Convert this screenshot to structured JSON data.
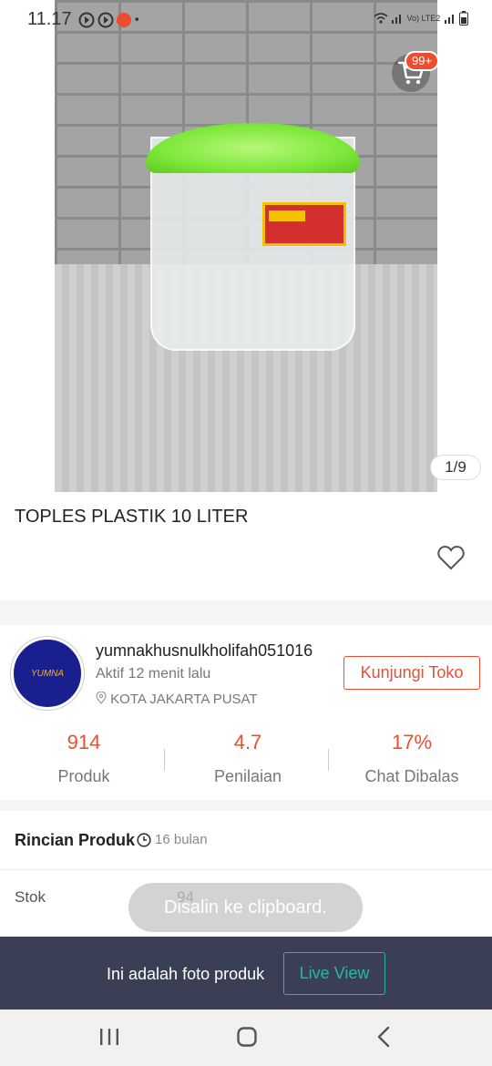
{
  "status_bar": {
    "time": "11.17",
    "network": "Vo) LTE2"
  },
  "header": {
    "cart_badge": "99+"
  },
  "gallery": {
    "counter": "1/9"
  },
  "product": {
    "title": "TOPLES PLASTIK 10 LITER"
  },
  "shop": {
    "logo_text": "YUMNA",
    "name": "yumnakhusnulkholifah051016",
    "active": "Aktif 12 menit lalu",
    "location": "KOTA JAKARTA PUSAT",
    "visit_label": "Kunjungi Toko",
    "stats": [
      {
        "value": "914",
        "label": "Produk"
      },
      {
        "value": "4.7",
        "label": "Penilaian"
      },
      {
        "value": "17%",
        "label": "Chat Dibalas"
      }
    ]
  },
  "details": {
    "heading": "Rincian Produk",
    "age": "16 bulan",
    "stock_label": "Stok",
    "stock_value": "94"
  },
  "toast": "Disalin ke clipboard.",
  "banner": {
    "text": "Ini adalah foto produk",
    "live_label": "Live View"
  },
  "colors": {
    "accent": "#ee4d2d",
    "live": "#26b8a6",
    "banner_bg": "#3b3f55"
  }
}
